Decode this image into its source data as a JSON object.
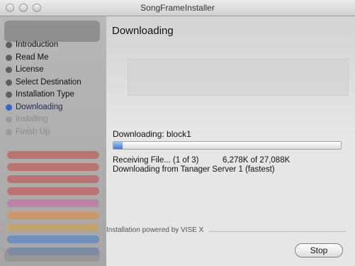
{
  "window": {
    "title": "SongFrameInstaller"
  },
  "steps": [
    {
      "label": "Introduction",
      "state": "done"
    },
    {
      "label": "Read Me",
      "state": "done"
    },
    {
      "label": "License",
      "state": "done"
    },
    {
      "label": "Select Destination",
      "state": "done"
    },
    {
      "label": "Installation Type",
      "state": "done"
    },
    {
      "label": "Downloading",
      "state": "active"
    },
    {
      "label": "Installing",
      "state": "pending"
    },
    {
      "label": "Finish Up",
      "state": "pending"
    }
  ],
  "main": {
    "heading": "Downloading",
    "downloading_label": "Downloading:  block1",
    "progress_percent": 4,
    "receiving": "Receiving File... (1 of 3)",
    "sizes": "6,278K of 27,088K",
    "server": "Downloading from Tanager Server 1 (fastest)",
    "powered_by": "Installation powered by VISE X",
    "stop_label": "Stop"
  },
  "colors": {
    "accent": "#3b76d8",
    "active_step": "#3a64c8"
  }
}
